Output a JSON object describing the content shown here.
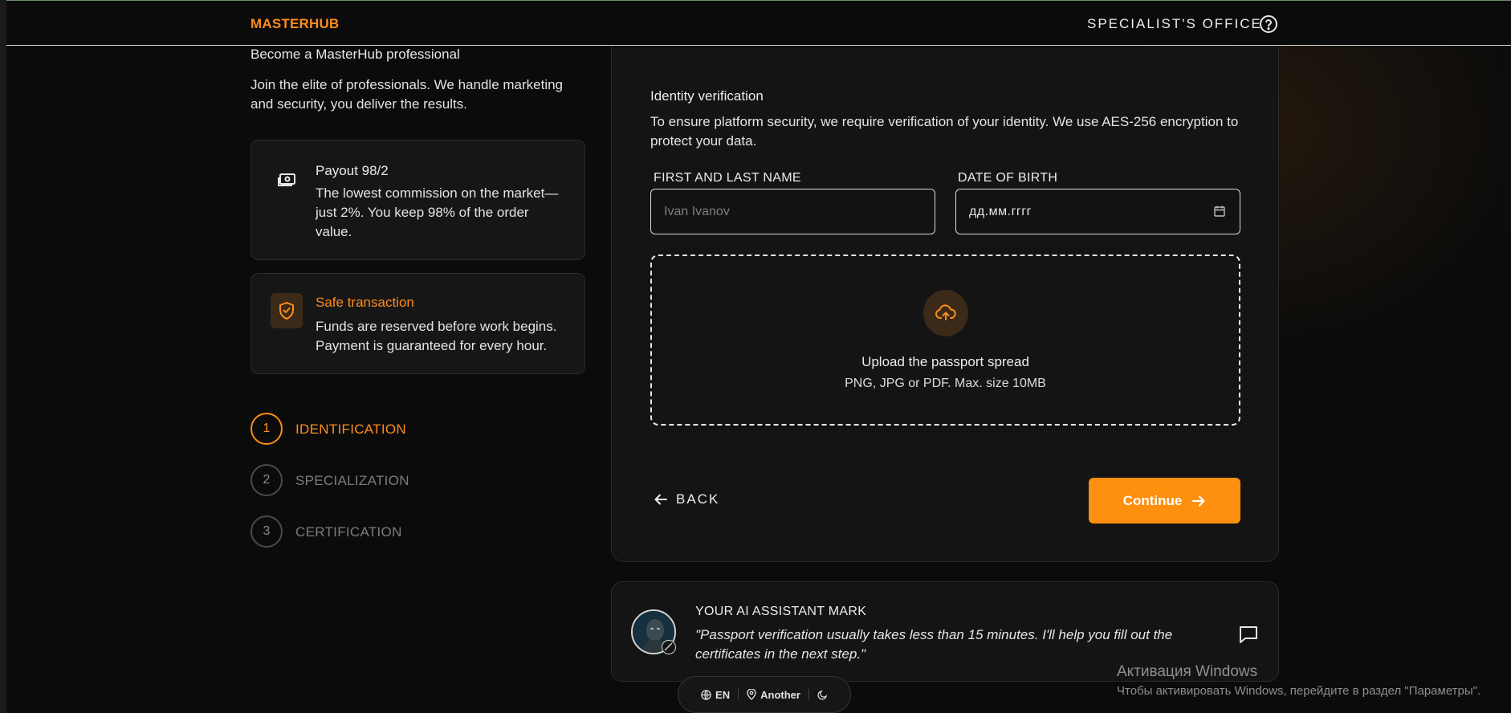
{
  "header": {
    "logo": "MASTERHUB",
    "office_label": "SPECIALIST'S OFFICE",
    "help_icon": "question-circle-icon"
  },
  "promo": {
    "title": "Become a MasterHub professional",
    "text": "Join the elite of professionals. We handle marketing and security, you deliver the results."
  },
  "features": [
    {
      "icon": "cash-icon",
      "title": "Payout 98/2",
      "text": "The lowest commission on the market—just 2%. You keep 98% of the order value."
    },
    {
      "icon": "shield-check-icon",
      "title": "Safe transaction",
      "text": "Funds are reserved before work begins. Payment is guaranteed for every hour."
    }
  ],
  "steps": [
    {
      "num": "1",
      "label": "IDENTIFICATION",
      "active": true
    },
    {
      "num": "2",
      "label": "SPECIALIZATION",
      "active": false
    },
    {
      "num": "3",
      "label": "CERTIFICATION",
      "active": false
    }
  ],
  "form": {
    "title": "Identity verification",
    "description": "To ensure platform security, we require verification of your identity. We use AES-256 encryption to protect your data.",
    "name_label": "FIRST AND LAST NAME",
    "name_placeholder": "Ivan Ivanov",
    "name_value": "",
    "dob_label": "DATE OF BIRTH",
    "dob_value": "дд.мм.гггг",
    "upload_title": "Upload the passport spread",
    "upload_hint": "PNG, JPG or PDF. Max. size 10MB",
    "back_label": "BACK",
    "continue_label": "Continue"
  },
  "assistant": {
    "name": "YOUR AI ASSISTANT MARK",
    "message": "\"Passport verification usually takes less than 15 minutes. I'll help you fill out the certificates in the next step.\""
  },
  "toolbar": {
    "language": "EN",
    "location": "Another"
  },
  "windows_activation": {
    "title": "Активация Windows",
    "subtitle": "Чтобы активировать Windows, перейдите в раздел \"Параметры\"."
  },
  "colors": {
    "accent": "#ff8c1a",
    "background": "#0b0b0b",
    "card": "#141414"
  }
}
